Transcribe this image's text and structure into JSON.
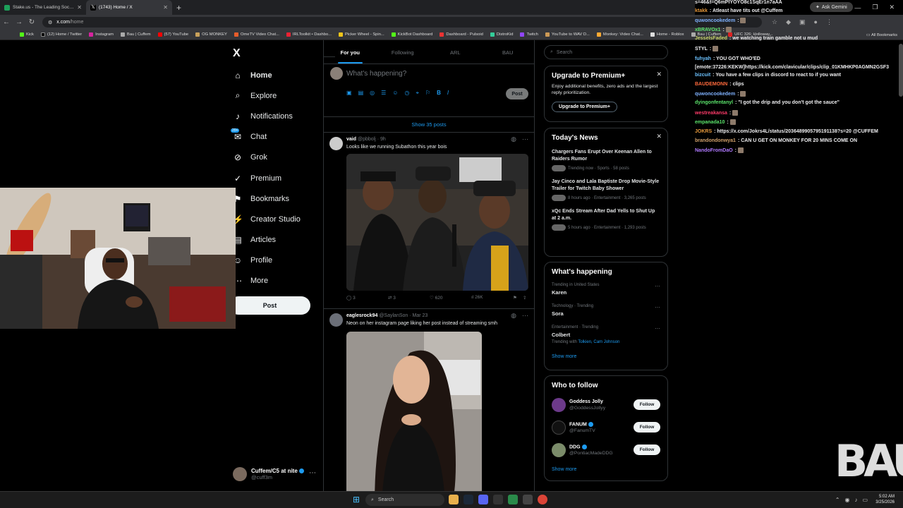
{
  "browser": {
    "tabs": [
      {
        "title": "Stake.us - The Leading Social C",
        "active": false
      },
      {
        "title": "(1743) Home / X",
        "active": true
      }
    ],
    "new_tab": "+",
    "url_host": "x.com",
    "url_path": "/home",
    "ask_gemini": "Ask Gemini",
    "bookmarks": [
      "Kick",
      "(12) Home / Twitter",
      "Instagram",
      "Bau | Cuffem",
      "(57) YouTube",
      "OG MONKEY",
      "OmeTV Video Chat...",
      "IRLToolkit • Dashbo...",
      "Picker Wheel - Spin...",
      "KickBot Dashboard",
      "Dashboard - Pulsoid",
      "DistroKid",
      "Twitch",
      "YouTube to WAV D...",
      "Monkey: Video Chat...",
      "Home - Roblox",
      "Bau | Cuffem",
      "UFC 326: Holloway..."
    ],
    "all_bookmarks": "All Bookmarks"
  },
  "nav": {
    "logo": "X",
    "items": [
      {
        "label": "Home",
        "icon": "home-icon"
      },
      {
        "label": "Explore",
        "icon": "search-icon"
      },
      {
        "label": "Notifications",
        "icon": "bell-icon"
      },
      {
        "label": "Chat",
        "icon": "chat-icon",
        "badge": "20+"
      },
      {
        "label": "Grok",
        "icon": "grok-icon"
      },
      {
        "label": "Premium",
        "icon": "premium-icon"
      },
      {
        "label": "Bookmarks",
        "icon": "bookmark-icon"
      },
      {
        "label": "Creator Studio",
        "icon": "studio-icon"
      },
      {
        "label": "Articles",
        "icon": "articles-icon"
      },
      {
        "label": "Profile",
        "icon": "profile-icon"
      },
      {
        "label": "More",
        "icon": "more-icon"
      }
    ],
    "post": "Post",
    "account": {
      "name": "Cuffem/C5 at nite",
      "handle": "@cuff3m"
    }
  },
  "feed": {
    "tabs": [
      "For you",
      "Following",
      "ARL",
      "BAU"
    ],
    "composer_placeholder": "What's happening?",
    "post_button": "Post",
    "show_posts": "Show 35 posts",
    "tweets": [
      {
        "name": "vaid",
        "handle": "@pbbolj",
        "time": "9h",
        "text": "Looks like we running Subathon this year bois",
        "replies": "3",
        "reposts": "3",
        "likes": "620",
        "views": "26K"
      },
      {
        "name": "eaglesrock94",
        "handle": "@SaylanSon",
        "time": "Mar 23",
        "text": "Neon on her instagram page liking her post instead of streaming smh"
      }
    ]
  },
  "right": {
    "search_placeholder": "Search",
    "premium": {
      "title": "Upgrade to Premium+",
      "text": "Enjoy additional benefits, zero ads and the largest reply prioritization.",
      "button": "Upgrade to Premium+"
    },
    "news": {
      "title": "Today's News",
      "items": [
        {
          "title": "Chargers Fans Erupt Over Keenan Allen to Raiders Rumor",
          "meta": "Trending now · Sports · 58 posts"
        },
        {
          "title": "Jay Cinco and Lala Baptiste Drop Movie-Style Trailer for Twitch Baby Shower",
          "meta": "8 hours ago · Entertainment · 3,265 posts"
        },
        {
          "title": "xQc Ends Stream After Dad Yells to Shut Up at 2 a.m.",
          "meta": "5 hours ago · Entertainment · 1,293 posts"
        }
      ]
    },
    "happening": {
      "title": "What's happening",
      "items": [
        {
          "context": "Trending in United States",
          "name": "Karen"
        },
        {
          "context": "Technology · Trending",
          "name": "Sora"
        },
        {
          "context": "Entertainment · Trending",
          "name": "Colbert",
          "sub_prefix": "Trending with",
          "sub_links": "Tolkien, Cam Johnson"
        }
      ],
      "show_more": "Show more"
    },
    "who": {
      "title": "Who to follow",
      "items": [
        {
          "name": "Goddess Jolly",
          "handle": "@GoddessJollyy",
          "button": "Follow"
        },
        {
          "name": "FANUM",
          "handle": "@FanumTV",
          "button": "Follow"
        },
        {
          "name": "DDG",
          "handle": "@PontiacMadeDDG",
          "button": "Follow"
        }
      ],
      "show_more": "Show more"
    }
  },
  "chat": [
    {
      "user": "",
      "text": "s=46&t=Q6mPIYOYO8c1SqEr1n7aAA",
      "color": "#efeff1"
    },
    {
      "user": "ktakk",
      "text": "Atleast have tits out @Cuffem",
      "color": "#e89a3c"
    },
    {
      "user": "quwoncookedem",
      "text": "",
      "color": "#7fb2ff"
    },
    {
      "user": "xBRAVOx1",
      "text": "",
      "color": "#5be36b"
    },
    {
      "user": "JesseIsFaded",
      "text": "we watching train gamble not u mud",
      "color": "#c9d66b"
    },
    {
      "user": "STYL",
      "text": "",
      "color": "#efeff1"
    },
    {
      "user": "fuhyah",
      "text": "YOU GOT WHO'ED [emote:37226:KEKW]https://kick.com/clavicular/clips/clip_01KMHKP0AGMN2GSF3",
      "color": "#6cc2ff"
    },
    {
      "user": "bizcuit",
      "text": "You have a few clips in discord to react to if you want",
      "color": "#6cc2ff"
    },
    {
      "user": "BAUDEMONN",
      "text": "clips",
      "color": "#ff6a3c"
    },
    {
      "user": "quwoncookedem",
      "text": "",
      "color": "#7fb2ff"
    },
    {
      "user": "dyingonfentanyl",
      "text": "\"I got the drip and you don't got the sauce\"",
      "color": "#5be36b"
    },
    {
      "user": "westreakansa",
      "text": "",
      "color": "#ff3c6a"
    },
    {
      "user": "empanada10",
      "text": "",
      "color": "#5be36b"
    },
    {
      "user": "JOKRS",
      "text": "https://x.com/Jokrs4L/status/2036489905795191138?s=20 @CUFFEM",
      "color": "#e89a3c"
    },
    {
      "user": "brandondonwya1",
      "text": "CAN U GET ON MONKEY FOR 20 MINS COME ON",
      "color": "#d0a06b"
    },
    {
      "user": "NandoFromDaO",
      "text": "",
      "color": "#b07aff"
    }
  ],
  "brand_logo": "BAU",
  "taskbar": {
    "search": "Search",
    "time": "5:02 AM",
    "date": "3/25/2026"
  }
}
